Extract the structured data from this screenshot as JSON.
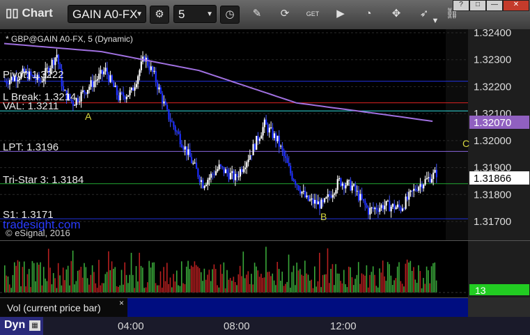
{
  "toolbar": {
    "title": "Chart",
    "symbol": "GAIN A0-FX",
    "interval": "5",
    "icons": [
      "settings-gear-icon",
      "clock-icon",
      "pencil-icon",
      "refresh-icon",
      "get-icon",
      "play-icon",
      "gauge-icon",
      "pin-icon",
      "rocket-icon",
      "link-icon",
      "funnel-icon"
    ]
  },
  "window": {
    "controls": [
      "?",
      "□",
      "—",
      "×"
    ]
  },
  "chart_header": "* GBP@GAIN A0-FX, 5 (Dynamic)",
  "overlays": {
    "pivot": "Pivot: 1.3222",
    "lbreak": "L Break: 1.3214",
    "val": "VAL: 1.3211",
    "lpt": "LPT: 1.3196",
    "tristar": "Tri-Star 3: 1.3184",
    "s1": "S1: 1.3171",
    "watermark": "tradesight.com",
    "copyright": "© eSignal, 2016",
    "marker_a": "A",
    "marker_b": "B",
    "marker_c": "C"
  },
  "price_axis": {
    "ticks": [
      "1.32400",
      "1.32300",
      "1.32200",
      "1.32100",
      "1.32000",
      "1.31900",
      "1.31800",
      "1.31700"
    ],
    "ma_value": "1.32070",
    "last_value": "1.31866"
  },
  "volume": {
    "last_value": "13"
  },
  "legend": {
    "label": "Vol (current price bar)",
    "close": "×"
  },
  "time_axis": {
    "mode": "Dyn",
    "labels": [
      "04:00",
      "08:00",
      "12:00"
    ]
  },
  "colors": {
    "up_candle": "#ffffff",
    "down_candle": "#1a2cff",
    "ma_line": "#a070e0",
    "vol_up": "#3aa83a",
    "vol_down": "#b82020",
    "last_price_box": "#ffffff",
    "ma_box": "#9060c0",
    "vol_box": "#22cc22"
  },
  "chart_data": {
    "type": "candlestick",
    "price_range": [
      1.3168,
      1.3242
    ],
    "levels": [
      {
        "name": "Pivot",
        "value": 1.3222
      },
      {
        "name": "L Break",
        "value": 1.3214
      },
      {
        "name": "VAL",
        "value": 1.3211
      },
      {
        "name": "LPT",
        "value": 1.3196
      },
      {
        "name": "Tri-Star 3",
        "value": 1.3184
      },
      {
        "name": "S1",
        "value": 1.3171
      }
    ],
    "moving_average_last": 1.3207,
    "last_price": 1.31866,
    "volume_last": 13
  }
}
